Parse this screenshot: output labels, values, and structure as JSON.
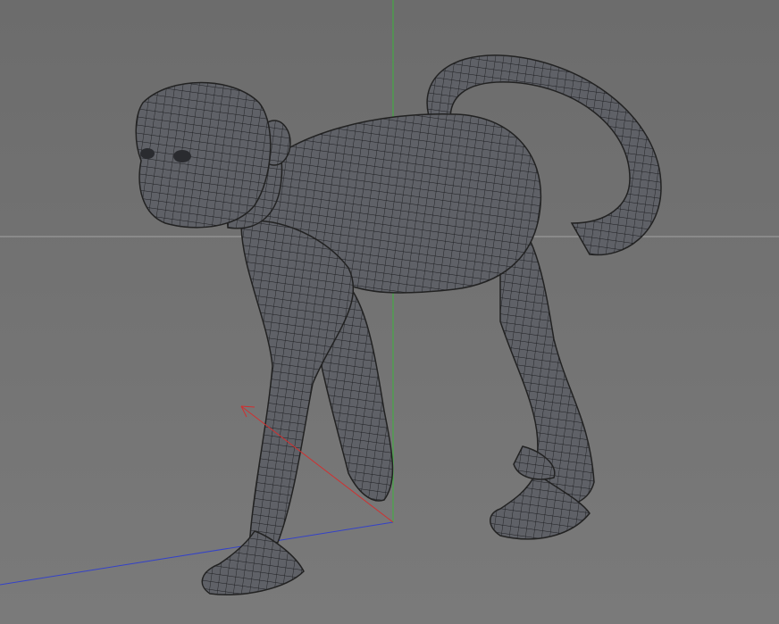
{
  "viewport": {
    "background": "#727272",
    "mesh_fill": "#5e6066",
    "mesh_wire": "#1e1f22",
    "axis_colors": {
      "x": "#d03030",
      "y": "#30b030",
      "z": "#3040c0",
      "horizon": "#a0a0a0"
    }
  }
}
